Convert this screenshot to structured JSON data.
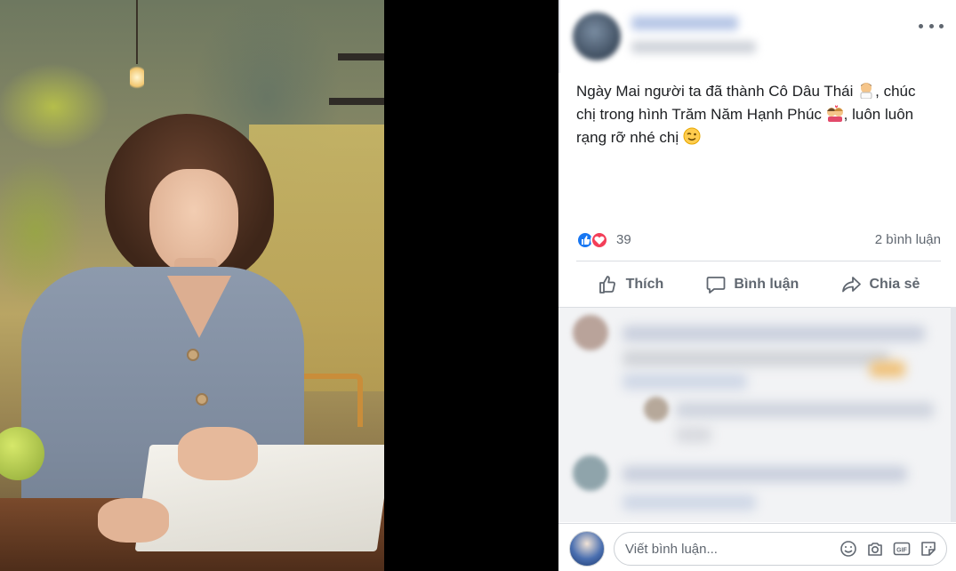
{
  "post": {
    "text_line1": "Ngày Mai người ta đã thành Cô Dâu Thái",
    "text_line1b": ", chúc",
    "text_line2": "chị trong hình Trăm Năm Hạnh Phúc",
    "text_line2b": ", luôn luôn",
    "text_line3": "rạng rỡ nhé chị"
  },
  "stats": {
    "reaction_count": "39",
    "comment_count": "2 bình luận"
  },
  "actions": {
    "like": "Thích",
    "comment": "Bình luận",
    "share": "Chia sẻ"
  },
  "composer": {
    "placeholder": "Viết bình luận..."
  },
  "colors": {
    "like_blue": "#1877f2",
    "love_red": "#f33e58",
    "text": "#1c1e21",
    "secondary": "#606770"
  }
}
